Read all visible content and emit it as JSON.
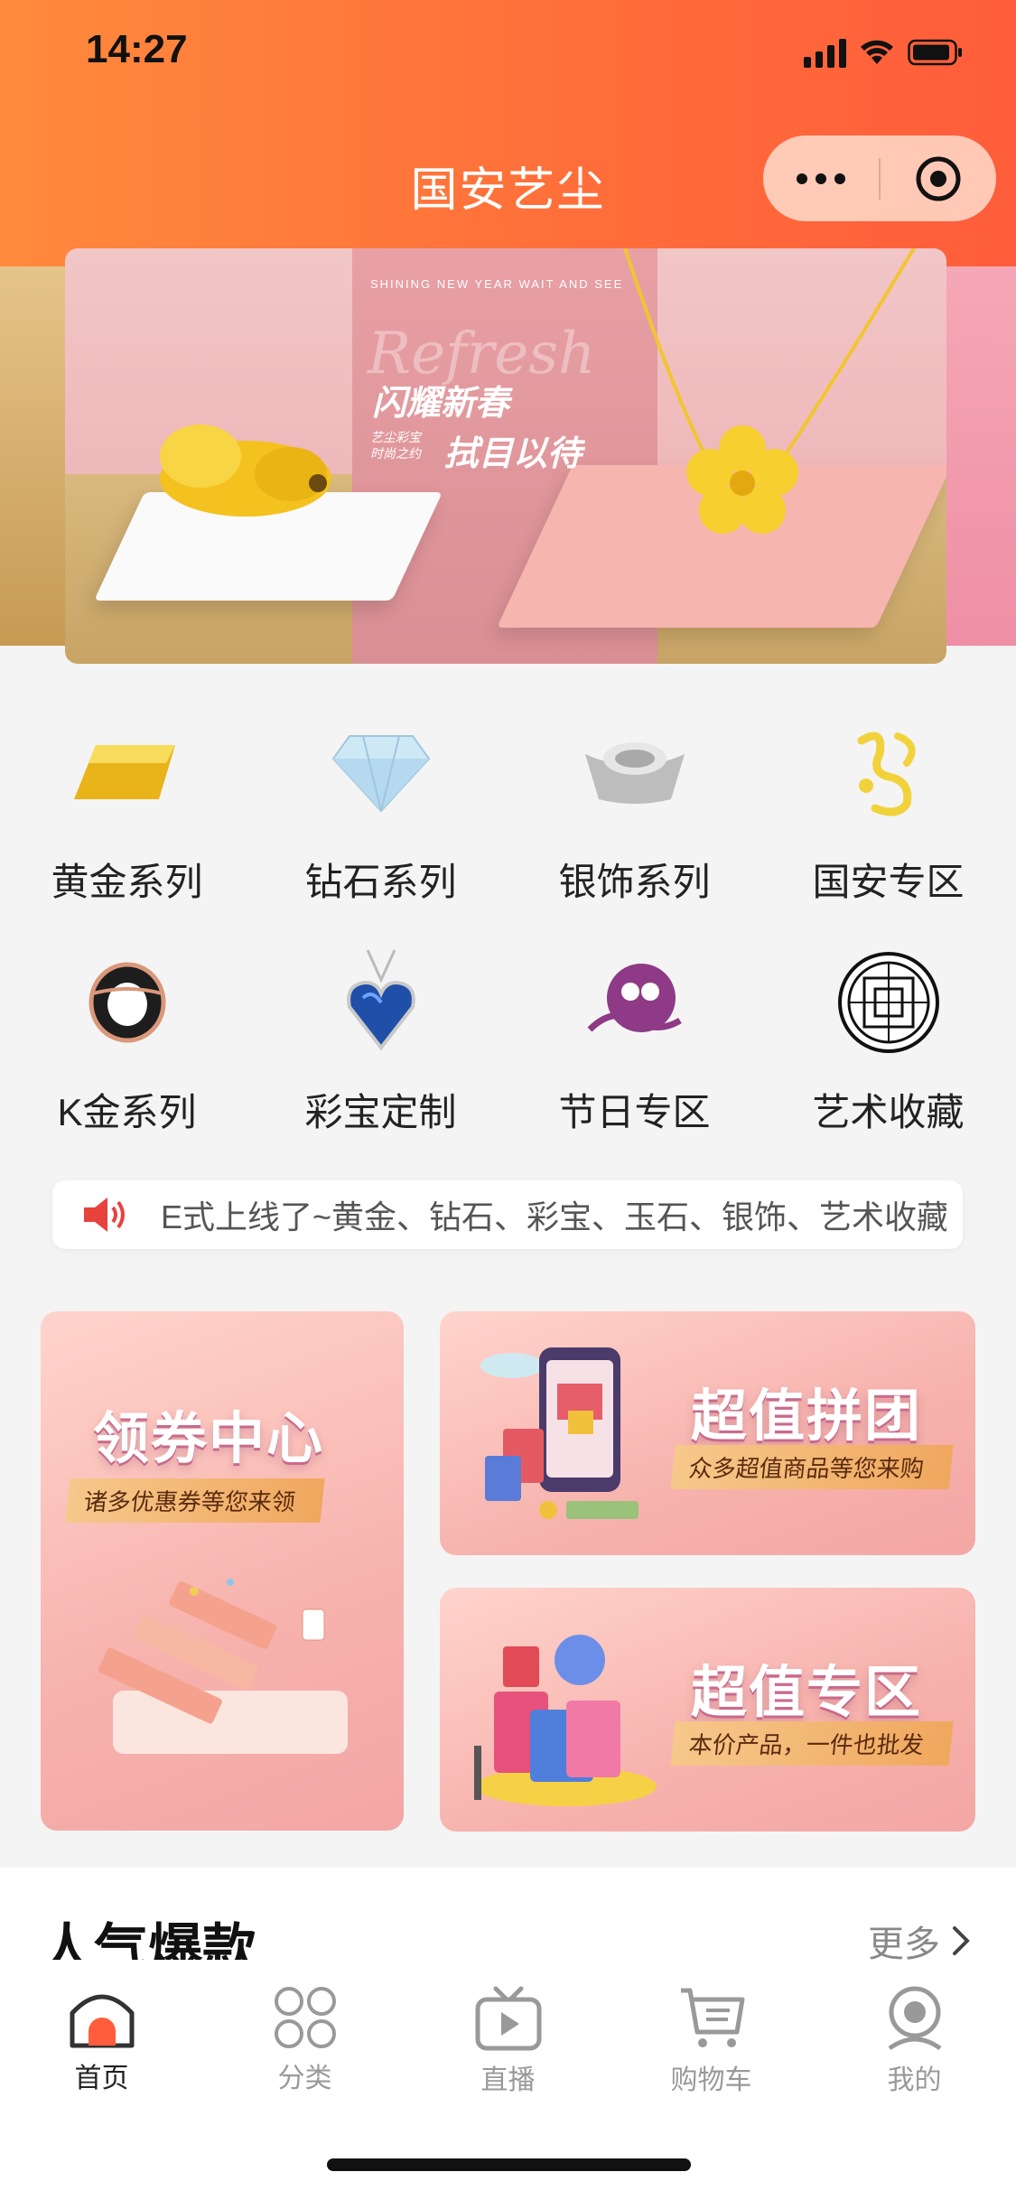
{
  "status_bar": {
    "time": "14:27"
  },
  "nav": {
    "title": "国安艺尘"
  },
  "banner": {
    "tagline_en": "SHINING NEW YEAR WAIT AND SEE",
    "script_word": "Refresh",
    "headline_1": "闪耀新春",
    "small_text": "艺尘彩宝 时尚之约",
    "headline_2": "拭目以待"
  },
  "categories": [
    {
      "label": "黄金系列",
      "icon": "gold-bar-icon"
    },
    {
      "label": "钻石系列",
      "icon": "diamond-icon"
    },
    {
      "label": "银饰系列",
      "icon": "silver-ingot-icon"
    },
    {
      "label": "国安专区",
      "icon": "guoan-logo-icon"
    },
    {
      "label": "K金系列",
      "icon": "ring-icon"
    },
    {
      "label": "彩宝定制",
      "icon": "gem-pendant-icon"
    },
    {
      "label": "节日专区",
      "icon": "festival-icon"
    },
    {
      "label": "艺术收藏",
      "icon": "art-pattern-icon"
    }
  ],
  "notice": {
    "text": "E式上线了~黄金、钻石、彩宝、玉石、银饰、艺术收藏"
  },
  "promos": {
    "coupon": {
      "title": "领券中心",
      "subtitle": "诸多优惠券等您来领"
    },
    "group": {
      "title": "超值拼团",
      "subtitle": "众多超值商品等您来购"
    },
    "value": {
      "title": "超值专区",
      "subtitle": "本价产品，一件也批发"
    }
  },
  "hot": {
    "title": "人气爆款",
    "more": "更多"
  },
  "tabbar": [
    {
      "label": "首页",
      "icon": "home-icon",
      "active": true
    },
    {
      "label": "分类",
      "icon": "category-icon",
      "active": false
    },
    {
      "label": "直播",
      "icon": "live-tv-icon",
      "active": false
    },
    {
      "label": "购物车",
      "icon": "cart-icon",
      "active": false
    },
    {
      "label": "我的",
      "icon": "profile-icon",
      "active": false
    }
  ],
  "colors": {
    "header_start": "#ff8a3d",
    "header_end": "#ff5d3b",
    "accent": "#ff5d3b"
  }
}
